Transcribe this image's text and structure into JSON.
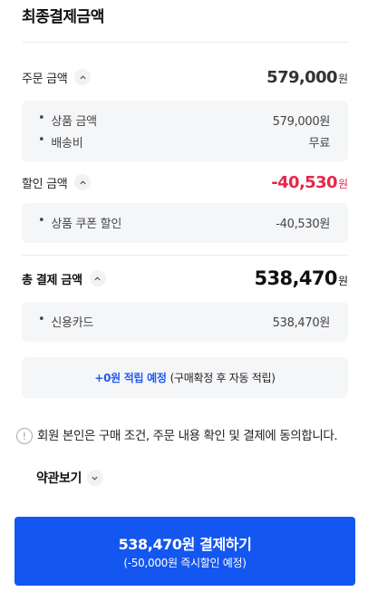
{
  "header": {
    "title": "최종결제금액"
  },
  "order": {
    "label": "주문 금액",
    "amount": "579,000",
    "unit": "원",
    "items": [
      {
        "bullet": "•",
        "label": "상품 금액",
        "value": "579,000원"
      },
      {
        "bullet": "•",
        "label": "배송비",
        "value": "무료"
      }
    ]
  },
  "discount": {
    "label": "할인 금액",
    "amount": "-40,530",
    "unit": "원",
    "color": "#e8264b",
    "items": [
      {
        "bullet": "•",
        "label": "상품 쿠폰 할인",
        "value": "-40,530원"
      }
    ]
  },
  "total": {
    "label": "총 결제 금액",
    "amount": "538,470",
    "unit": "원",
    "items": [
      {
        "bullet": "•",
        "label": "신용카드",
        "value": "538,470원"
      }
    ]
  },
  "points": {
    "highlight": "+0원 적립 예정",
    "note": "(구매확정 후 자동 적립)",
    "color": "#1f5af5"
  },
  "notice": {
    "icon": "info-icon",
    "icon_glyph": "!",
    "text": "회원 본인은 구매 조건, 주문 내용 확인 및 결제에 동의합니다."
  },
  "terms": {
    "label": "약관보기"
  },
  "pay_button": {
    "label": "538,470원 결제하기",
    "sub": "(-50,000원 즉시할인 예정)",
    "color": "#1456f0"
  }
}
